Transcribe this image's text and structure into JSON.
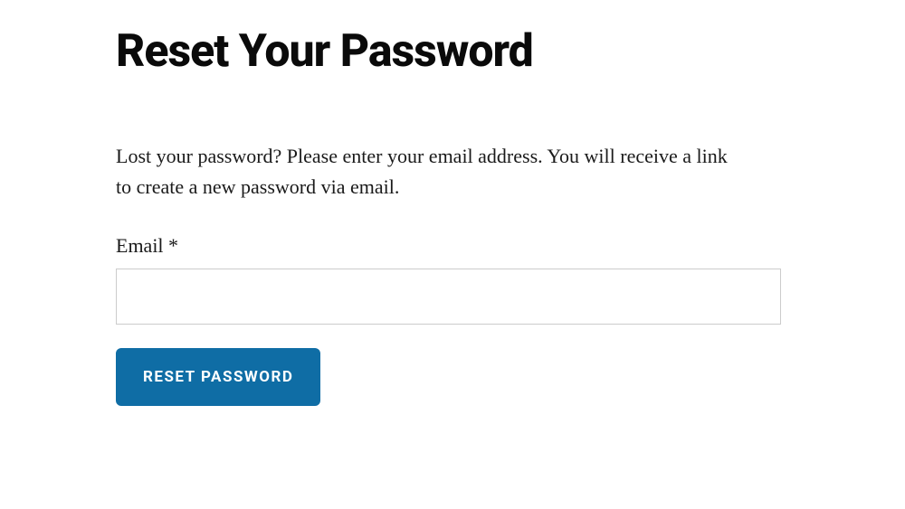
{
  "page": {
    "title": "Reset Your Password",
    "instructions": "Lost your password? Please enter your email address. You will receive a link to create a new password via email."
  },
  "form": {
    "email_label": "Email *",
    "email_value": "",
    "submit_label": "RESET PASSWORD"
  },
  "colors": {
    "primary": "#0f6da5",
    "text": "#1a1a1a",
    "heading": "#0a0a0a",
    "border": "#cccccc"
  }
}
